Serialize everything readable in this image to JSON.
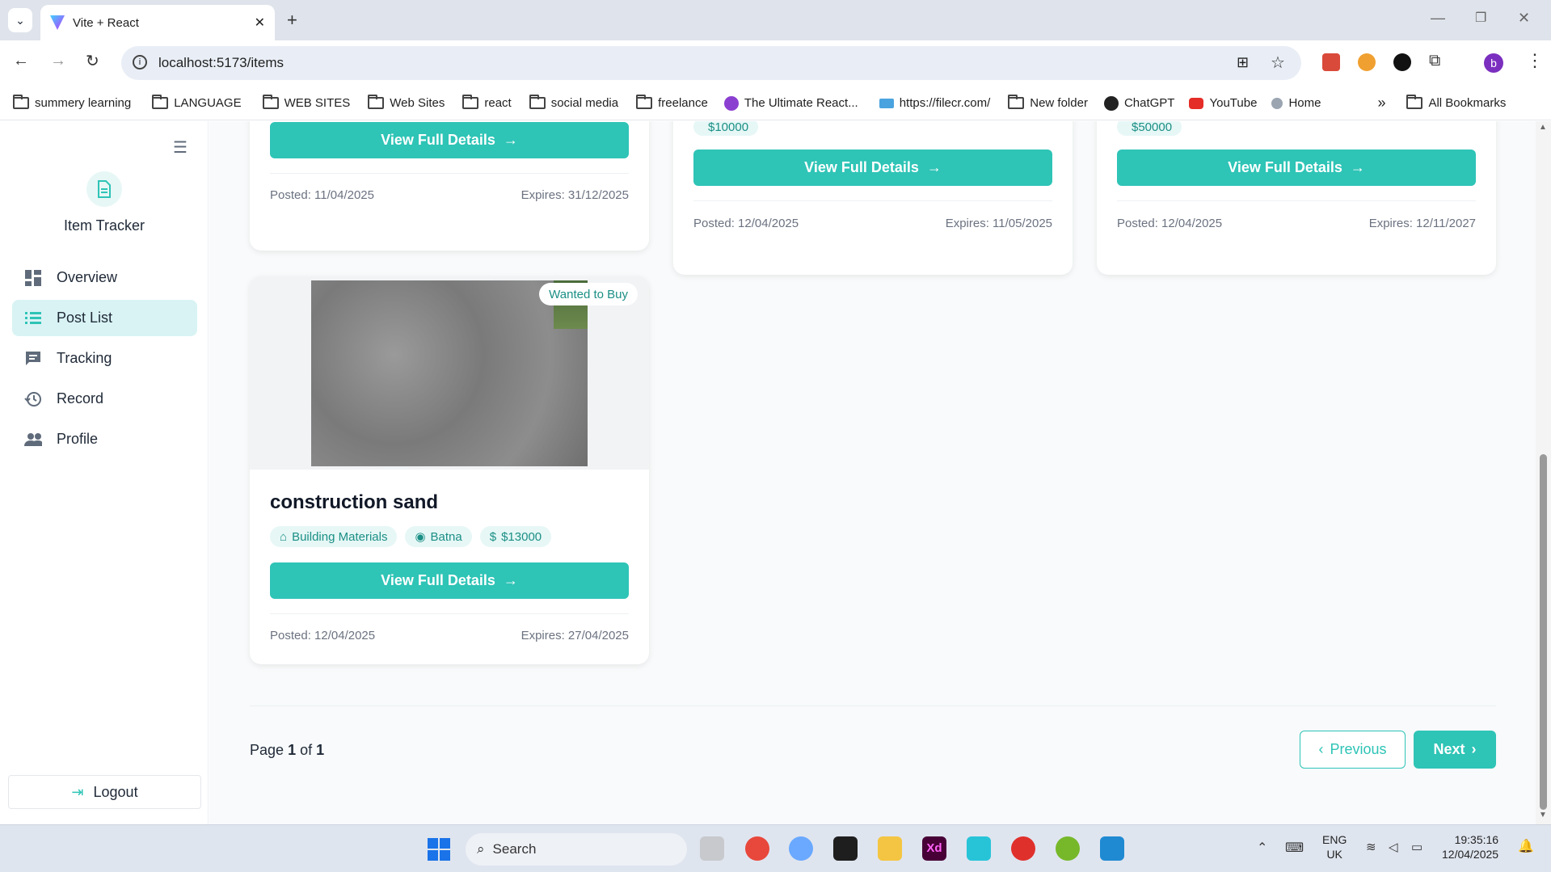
{
  "browser": {
    "tab_title": "Vite + React",
    "url": "localhost:5173/items",
    "bookmarks": [
      "summery learning",
      "LANGUAGE",
      "WEB SITES",
      "Web Sites",
      "react",
      "social media",
      "freelance",
      "The Ultimate React...",
      "https://filecr.com/",
      "New folder",
      "ChatGPT",
      "YouTube",
      "Home"
    ],
    "all_bookmarks": "All Bookmarks",
    "profile_initial": "b"
  },
  "sidebar": {
    "app_name": "Item Tracker",
    "items": [
      {
        "label": "Overview",
        "icon": "dashboard-icon"
      },
      {
        "label": "Post List",
        "icon": "list-icon",
        "active": true
      },
      {
        "label": "Tracking",
        "icon": "chat-icon"
      },
      {
        "label": "Record",
        "icon": "history-icon"
      },
      {
        "label": "Profile",
        "icon": "people-icon"
      }
    ],
    "logout": "Logout"
  },
  "cards_top": [
    {
      "price": null,
      "button": "View Full Details",
      "posted": "Posted: 11/04/2025",
      "expires": "Expires: 31/12/2025"
    },
    {
      "price": "$10000",
      "button": "View Full Details",
      "posted": "Posted: 12/04/2025",
      "expires": "Expires: 11/05/2025"
    },
    {
      "price": "$50000",
      "button": "View Full Details",
      "posted": "Posted: 12/04/2025",
      "expires": "Expires: 12/11/2027"
    }
  ],
  "card_main": {
    "badge": "Wanted to Buy",
    "title": "construction sand",
    "category": "Building Materials",
    "location": "Batna",
    "price": "$13000",
    "button": "View Full Details",
    "posted": "Posted: 12/04/2025",
    "expires": "Expires: 27/04/2025"
  },
  "pagination": {
    "prefix": "Page",
    "current": "1",
    "of": "of",
    "total": "1",
    "previous": "Previous",
    "next": "Next"
  },
  "taskbar": {
    "search": "Search",
    "lang1": "ENG",
    "lang2": "UK",
    "time": "19:35:16",
    "date": "12/04/2025"
  },
  "colors": {
    "accent": "#2ec4b6",
    "active_bg": "#d9f3f4"
  }
}
